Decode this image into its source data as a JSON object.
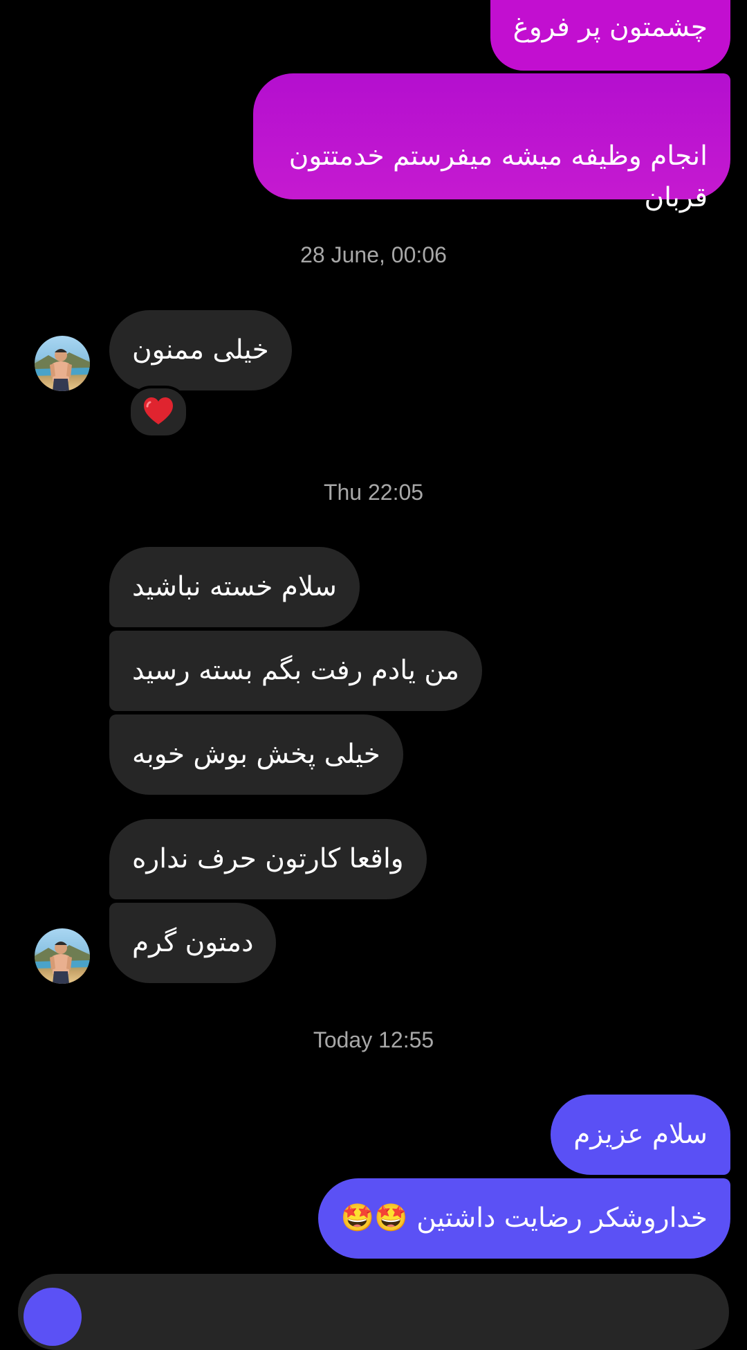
{
  "colors": {
    "background": "#000000",
    "incoming_bubble": "#262626",
    "outgoing_gradient_top": "#b20ed0",
    "outgoing_gradient_bottom": "#c619cf",
    "outgoing_purple": "#c212d1",
    "outgoing_blue": "#5b51f5",
    "timestamp_text": "#a8a8a8"
  },
  "conversation": {
    "messages_top": [
      {
        "text": "چشمتون پر فروغ",
        "direction": "outgoing"
      },
      {
        "text": "انجام وظیفه میشه میفرستم خدمتتون\nقربان",
        "direction": "outgoing"
      }
    ],
    "timestamp_1": "28 June, 00:06",
    "group_1": [
      {
        "text": "خیلی ممنون",
        "direction": "incoming",
        "reaction": "red-heart"
      }
    ],
    "timestamp_2": "Thu 22:05",
    "group_2": [
      {
        "text": "سلام خسته نباشید",
        "direction": "incoming"
      },
      {
        "text": "من یادم رفت بگم بسته رسید",
        "direction": "incoming"
      },
      {
        "text": "خیلی پخش بوش خوبه",
        "direction": "incoming"
      },
      {
        "text": "واقعا کارتون حرف نداره",
        "direction": "incoming"
      },
      {
        "text": "دمتون گرم",
        "direction": "incoming"
      }
    ],
    "timestamp_3": "Today 12:55",
    "group_3": [
      {
        "text": "سلام عزیزم",
        "direction": "outgoing"
      },
      {
        "text": "خداروشکر رضایت داشتین 🤩🤩",
        "direction": "outgoing"
      }
    ]
  },
  "icons": {
    "avatar": "profile-photo-avatar",
    "reaction": "red-heart-icon",
    "composer": "camera-icon"
  }
}
